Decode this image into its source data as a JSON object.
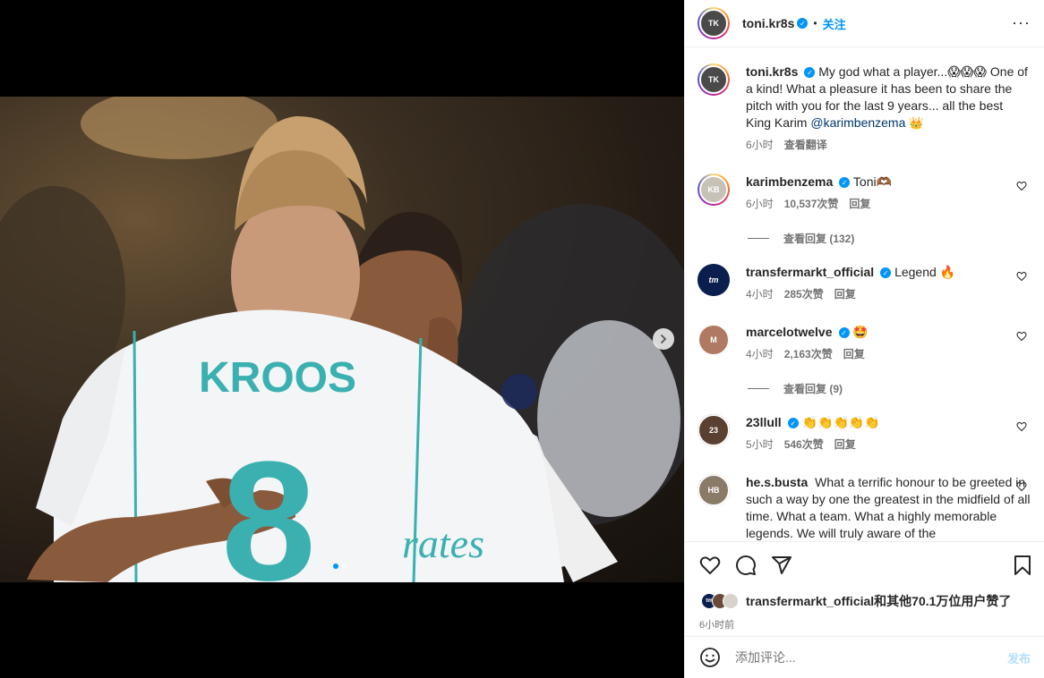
{
  "media": {
    "jersey_name": "KROOS",
    "jersey_number": "8",
    "sponsor_text": "rates",
    "carousel": {
      "current": 1,
      "total": 2
    }
  },
  "header": {
    "username": "toni.kr8s",
    "bullet": "•",
    "follow_label": "关注",
    "more_label": "···"
  },
  "caption": {
    "username": "toni.kr8s",
    "text": "My god what a player...😱😱😱 One of a kind! What a pleasure it has been to share the pitch with you for the last 9 years... all the best King Karim",
    "mention": "@karimbenzema",
    "trailing_emoji": "👑",
    "time": "6小时",
    "translate_label": "查看翻译"
  },
  "comments": [
    {
      "username": "karimbenzema",
      "verified": true,
      "text": "Toni🫶🏾",
      "time": "6小时",
      "likes": "10,537次赞",
      "reply_label": "回复",
      "view_replies": "查看回复 (132)"
    },
    {
      "username": "transfermarkt_official",
      "verified": true,
      "text": "Legend 🔥",
      "time": "4小时",
      "likes": "285次赞",
      "reply_label": "回复"
    },
    {
      "username": "marcelotwelve",
      "verified": true,
      "text": "🤩",
      "time": "4小时",
      "likes": "2,163次赞",
      "reply_label": "回复",
      "view_replies": "查看回复 (9)"
    },
    {
      "username": "23llull",
      "verified": true,
      "text": "👏👏👏👏👏",
      "time": "5小时",
      "likes": "546次赞",
      "reply_label": "回复"
    },
    {
      "username": "he.s.busta",
      "verified": false,
      "text": "What a terrific honour to be greeted in such a way by one the greatest in the midfield of all time. What a team. What a highly memorable legends. We will truly aware of the"
    }
  ],
  "likes": {
    "first_liker": "transfermarkt_official",
    "rest_text": "和其他70.1万位用户赞了"
  },
  "post_time": "6小时前",
  "add_comment": {
    "placeholder": "添加评论...",
    "post_label": "发布"
  },
  "colors": {
    "accent": "#0095f6",
    "text": "#262626",
    "secondary": "#737373",
    "jersey_trim": "#3ab0b0"
  }
}
